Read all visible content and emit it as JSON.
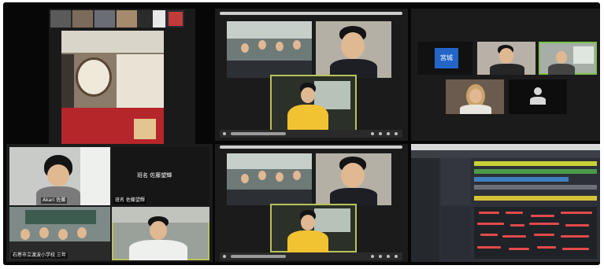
{
  "classroom": {
    "sign_label": "班名 佐藤望輝",
    "student_label": "Akari 佐藤",
    "class_label": "石巻市立渡波小学校 三年",
    "meeting_label": "班名 佐藤望輝"
  },
  "grid_top": {
    "icon_label": "宮城"
  },
  "colors": {
    "active_speaker": "#b9c25a",
    "highlight_green": "#7fbf4e",
    "daw_note": "#e24a4a",
    "daw_region": "#c8d23a",
    "brand_blue": "#2466c8"
  }
}
